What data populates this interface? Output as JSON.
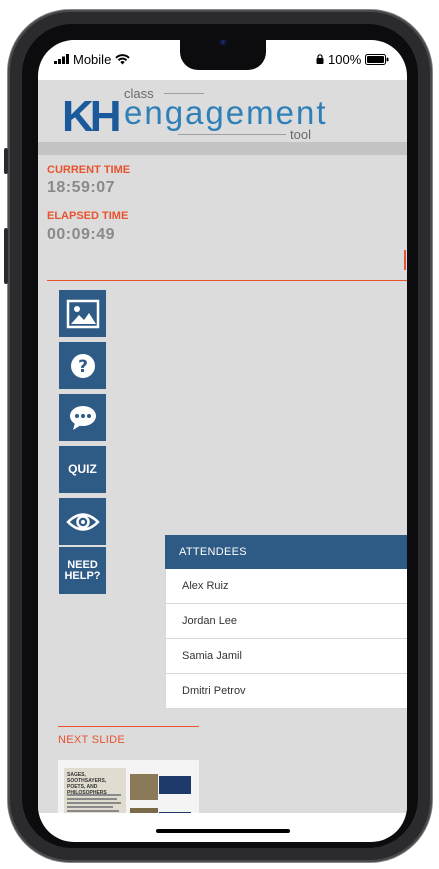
{
  "status_bar": {
    "carrier": "Mobile",
    "battery": "100%"
  },
  "logo": {
    "mark": "KH",
    "word_top": "class",
    "word_main": "engagement",
    "word_bottom": "tool"
  },
  "timers": {
    "current_label": "CURRENT TIME",
    "current_value": "18:59:07",
    "elapsed_label": "ELAPSED TIME",
    "elapsed_value": "00:09:49"
  },
  "tools": [
    {
      "name": "image-icon",
      "label": ""
    },
    {
      "name": "question-icon",
      "label": ""
    },
    {
      "name": "chat-bubble-icon",
      "label": ""
    },
    {
      "name": "quiz",
      "label": "QUIZ"
    },
    {
      "name": "eye-icon",
      "label": ""
    },
    {
      "name": "need-help",
      "label": "NEED HELP?"
    }
  ],
  "attendees": {
    "header": "ATTENDEES",
    "list": [
      "Alex Ruiz",
      "Jordan Lee",
      "Samia Jamil",
      "Dmitri Petrov"
    ]
  },
  "next_slide": {
    "label": "NEXT SLIDE",
    "title": "SAGES, SOOTHSAYERS, POETS, AND PHILOSOPHERS"
  },
  "colors": {
    "accent": "#e8532f",
    "primary": "#2e5a86",
    "logo_blue": "#1b5a9a",
    "background": "#dcdcdc"
  }
}
